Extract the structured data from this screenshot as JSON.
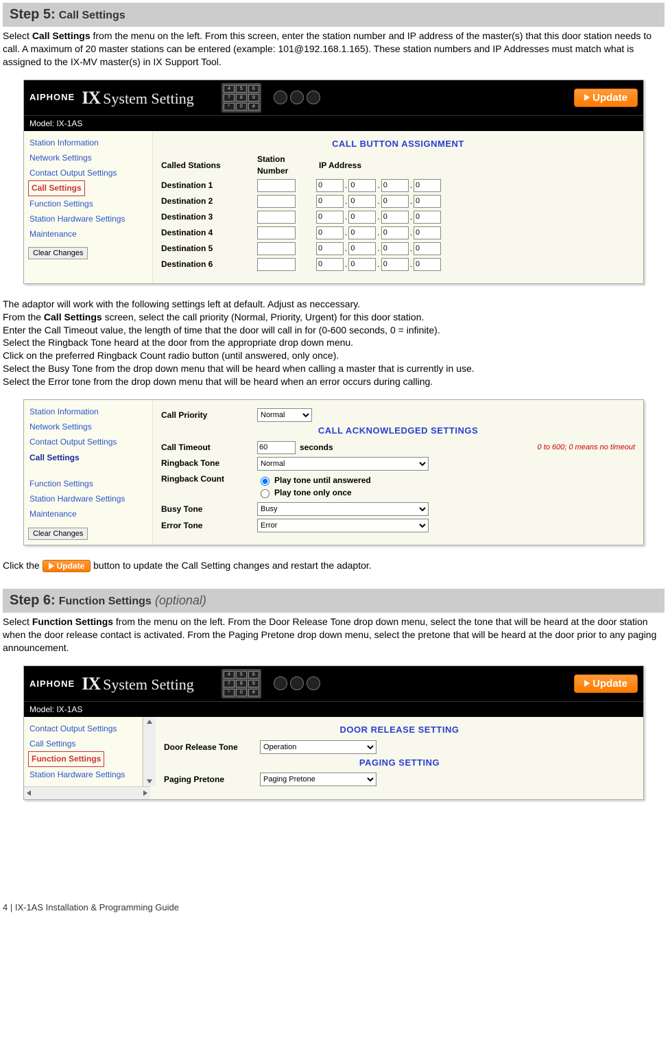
{
  "step5": {
    "header_step": "Step 5:",
    "header_title": "Call Settings",
    "intro_pre": "Select ",
    "intro_bold": "Call Settings",
    "intro_post": " from the menu on the left. From this screen, enter the station number and IP address of the master(s) that this door station needs to call. A maximum of 20 master stations can be entered (example: 101@192.168.1.165). These station numbers and IP Addresses must match what is assigned to the IX-MV master(s) in IX Support Tool."
  },
  "panel1": {
    "brand": "AIPHONE",
    "title_ix": "IX",
    "title_rest": "System Setting",
    "update": "Update",
    "model": "Model: IX-1AS",
    "nav": [
      "Station Information",
      "Network Settings",
      "Contact Output Settings",
      "Call Settings",
      "Function Settings",
      "Station Hardware Settings",
      "Maintenance"
    ],
    "nav_active_index": 3,
    "clear": "Clear Changes",
    "section_title": "CALL BUTTON ASSIGNMENT",
    "called_stations": "Called Stations",
    "col_station": "Station Number",
    "col_ip": "IP Address",
    "destinations": [
      {
        "label": "Destination 1",
        "station": "",
        "ip": [
          "0",
          "0",
          "0",
          "0"
        ]
      },
      {
        "label": "Destination 2",
        "station": "",
        "ip": [
          "0",
          "0",
          "0",
          "0"
        ]
      },
      {
        "label": "Destination 3",
        "station": "",
        "ip": [
          "0",
          "0",
          "0",
          "0"
        ]
      },
      {
        "label": "Destination 4",
        "station": "",
        "ip": [
          "0",
          "0",
          "0",
          "0"
        ]
      },
      {
        "label": "Destination 5",
        "station": "",
        "ip": [
          "0",
          "0",
          "0",
          "0"
        ]
      },
      {
        "label": "Destination 6",
        "station": "",
        "ip": [
          "0",
          "0",
          "0",
          "0"
        ]
      }
    ]
  },
  "mid_text": {
    "l1": "The adaptor will work with the following settings left at default. Adjust as neccessary.",
    "l2_pre": "From the ",
    "l2_bold": "Call Settings",
    "l2_post": " screen, select the call priority (Normal, Priority, Urgent) for this door station.",
    "l3": "Enter the Call Timeout value, the length of time that the door will call in for (0-600 seconds, 0 = infinite).",
    "l4": "Select the Ringback Tone heard at the door from the appropriate drop down menu.",
    "l5": "Click on the preferred Ringback Count radio button (until answered, only once).",
    "l6": "Select the Busy Tone from the drop down menu that will be heard when calling a master that is currently in use.",
    "l7": "Select the Error tone from the drop down menu that will be heard when an error occurs during calling."
  },
  "panel2": {
    "nav": [
      "Station Information",
      "Network Settings",
      "Contact Output Settings",
      "Call Settings",
      "Function Settings",
      "Station Hardware Settings",
      "Maintenance"
    ],
    "nav_active_index": 3,
    "clear": "Clear Changes",
    "call_priority_lbl": "Call Priority",
    "call_priority_val": "Normal",
    "section_title": "CALL ACKNOWLEDGED SETTINGS",
    "timeout_lbl": "Call Timeout",
    "timeout_val": "60",
    "timeout_unit": "seconds",
    "timeout_hint": "0 to 600; 0 means no timeout",
    "ringback_tone_lbl": "Ringback Tone",
    "ringback_tone_val": "Normal",
    "ringback_count_lbl": "Ringback Count",
    "ringback_opt1": "Play tone until answered",
    "ringback_opt2": "Play tone only once",
    "busy_lbl": "Busy Tone",
    "busy_val": "Busy",
    "error_lbl": "Error Tone",
    "error_val": "Error"
  },
  "click_line": {
    "pre": "Click the ",
    "btn": "Update",
    "post": " button to update the Call Setting changes and restart the adaptor."
  },
  "step6": {
    "header_step": "Step 6:",
    "header_title": "Function Settings",
    "header_opt": "(optional)",
    "intro_pre": "Select ",
    "intro_bold": "Function Settings",
    "intro_post": " from the menu on the left. From the Door Release Tone drop down menu, select the tone that will be heard at the door station when the door release contact is activated. From the Paging Pretone drop down menu, select the pretone that will be heard at the door prior to any paging announcement."
  },
  "panel3": {
    "brand": "AIPHONE",
    "title_ix": "IX",
    "title_rest": "System Setting",
    "update": "Update",
    "model": "Model: IX-1AS",
    "nav": [
      "Contact Output Settings",
      "Call Settings",
      "Function Settings",
      "Station Hardware Settings"
    ],
    "nav_active_index": 2,
    "section1": "DOOR RELEASE SETTING",
    "dr_lbl": "Door Release Tone",
    "dr_val": "Operation",
    "section2": "PAGING SETTING",
    "pp_lbl": "Paging Pretone",
    "pp_val": "Paging Pretone"
  },
  "footer": "4 | IX-1AS Installation & Programming Guide"
}
